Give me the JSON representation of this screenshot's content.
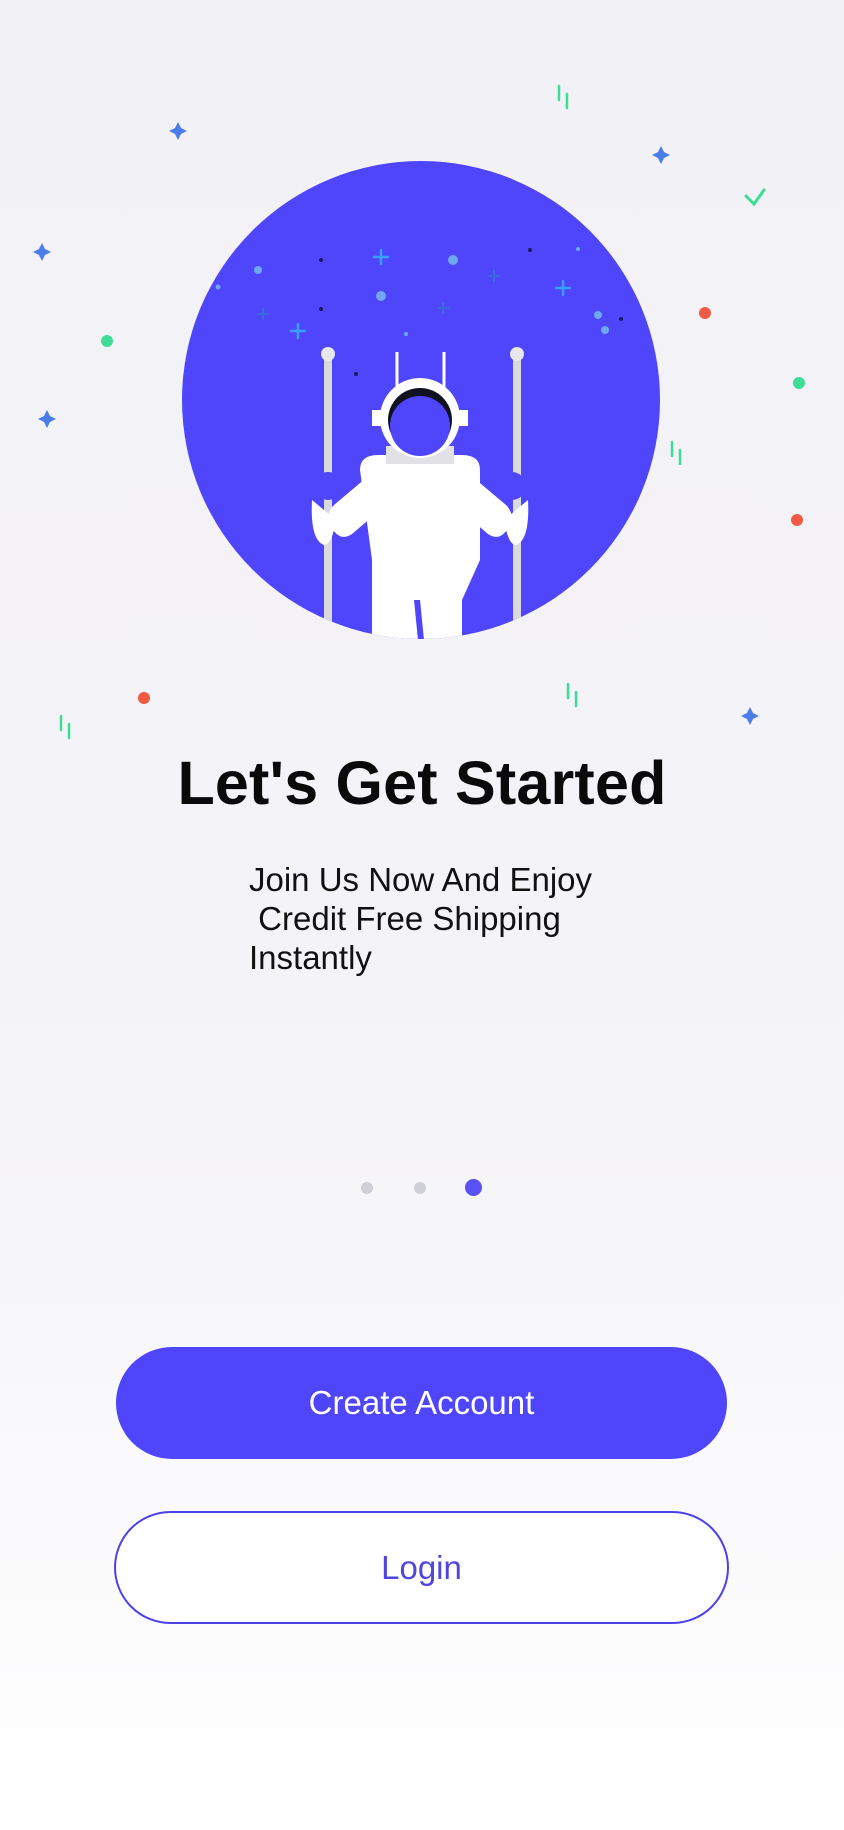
{
  "onboarding": {
    "title": "Let's Get Started",
    "subtitle": "Join Us Now And Enjoy\n Credit Free Shipping\nInstantly",
    "illustration_icon": "astronaut-on-swing-icon",
    "page_indicator": {
      "total": 3,
      "current": 3
    }
  },
  "actions": {
    "create_account_label": "Create Account",
    "login_label": "Login"
  },
  "colors": {
    "accent": "#4f46fb",
    "background": "#f3f2f7",
    "dot_inactive": "#cfcfd6",
    "dot_active": "#5b52f5",
    "confetti_green": "#3ddc97",
    "confetti_red": "#ef5a45",
    "confetti_blue": "#4a7de8"
  }
}
